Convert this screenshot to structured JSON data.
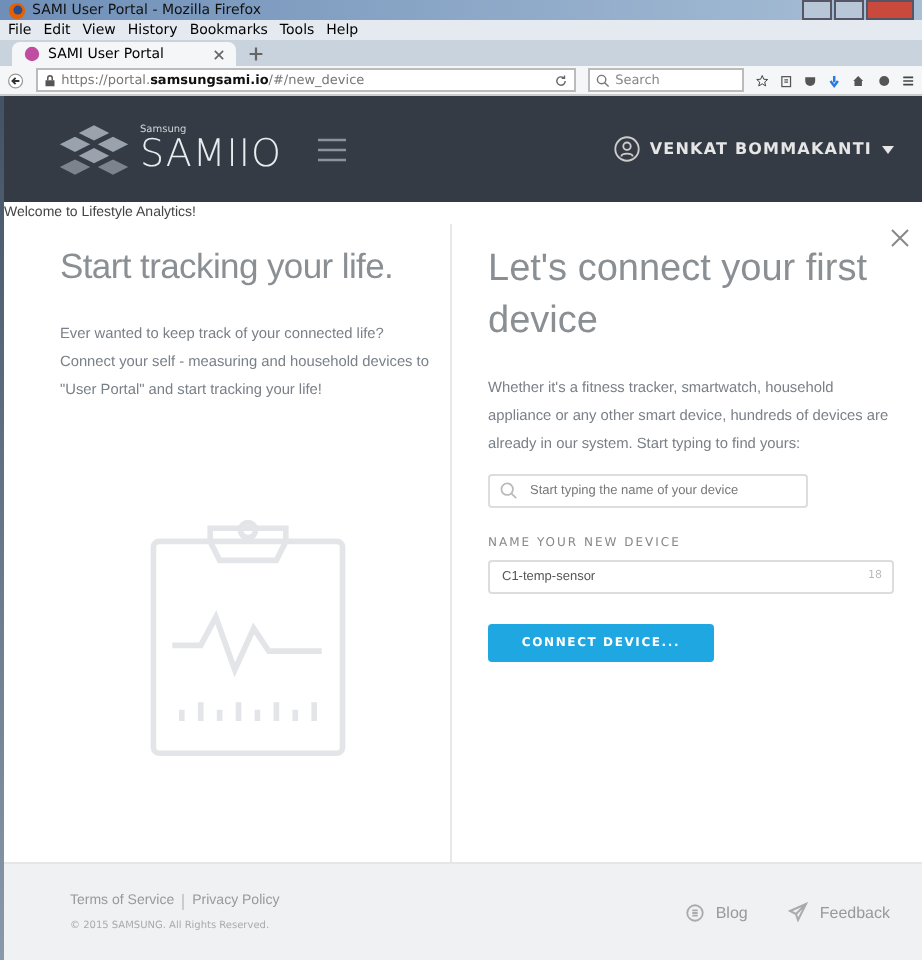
{
  "window": {
    "title": "SAMI User Portal - Mozilla Firefox"
  },
  "menu": [
    "File",
    "Edit",
    "View",
    "History",
    "Bookmarks",
    "Tools",
    "Help"
  ],
  "tabs": [
    {
      "label": "SAMI User Portal",
      "selected": true
    }
  ],
  "address_bar": {
    "url": "https://portal.**samsungsami.io**/#/new_device",
    "search_placeholder": "Search"
  },
  "header": {
    "brand_small": "Samsung",
    "brand": "SAMIIO",
    "user": "VENKAT BOMMAKANTI"
  },
  "welcome": "Welcome to Lifestyle Analytics!",
  "left_panel": {
    "title": "Start tracking your life.",
    "text": "Ever wanted to keep track of your connected life? Connect your self - measuring and household devices to \"User Portal\" and start tracking your life!"
  },
  "right_panel": {
    "title": "Let's connect your first device",
    "text": "Whether it's a fitness tracker, smartwatch, household appliance or any other smart device, hundreds of devices are already in our system. Start typing to find yours:",
    "search_placeholder": "Start typing the name of your device",
    "name_label": "NAME YOUR NEW DEVICE",
    "name_value": "C1-temp-sensor",
    "name_counter": "18",
    "button": "CONNECT DEVICE..."
  },
  "footer": {
    "links": [
      "Terms of Service",
      "Privacy Policy"
    ],
    "copyright": "© 2015 SAMSUNG. All Rights Reserved.",
    "blog": "Blog",
    "feedback": "Feedback"
  }
}
